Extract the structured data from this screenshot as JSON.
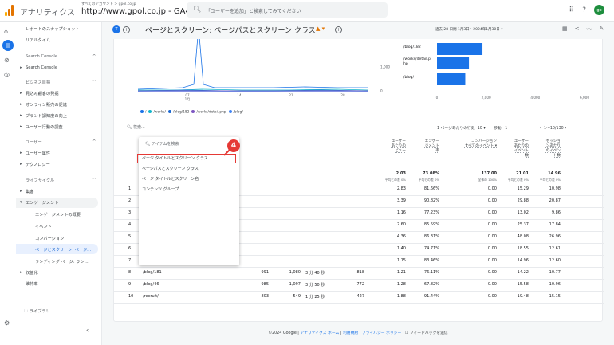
{
  "header": {
    "brand": "アナリティクス",
    "account_breadcrumb": "すべてのアカウント > gpol.co.jp",
    "property": "http://www.gpol.co.jp - GA4",
    "search_placeholder": "「ユーザーを追加」と検索してみてください",
    "avatar_initials": "gp"
  },
  "sidebar": {
    "items": [
      {
        "label": "レポートのスナップショット"
      },
      {
        "label": "リアルタイム"
      },
      {
        "label": "Search Console"
      },
      {
        "label": "Search Console"
      },
      {
        "label": "ビジネス目標"
      },
      {
        "label": "見込み顧客の発掘"
      },
      {
        "label": "オンライン販売の促進"
      },
      {
        "label": "ブランド認知度の向上"
      },
      {
        "label": "ユーザー行動の調査"
      },
      {
        "label": "ユーザー"
      },
      {
        "label": "ユーザー属性"
      },
      {
        "label": "テクノロジー"
      },
      {
        "label": "ライフサイクル"
      },
      {
        "label": "集客"
      },
      {
        "label": "エンゲージメント"
      },
      {
        "label": "エンゲージメントの概要"
      },
      {
        "label": "イベント"
      },
      {
        "label": "コンバージョン"
      },
      {
        "label": "ページとスクリーン: ページ..."
      },
      {
        "label": "ランディング ページ: ラン..."
      },
      {
        "label": "収益化"
      },
      {
        "label": "維持率"
      }
    ],
    "library": "ライブラリ"
  },
  "report": {
    "badge": "T",
    "title": "ページとスクリーン: ページパスとスクリーン クラス",
    "date_range": "過去 28 日間  1月3日～2024年1月30日",
    "warn_icon": "warning-icon"
  },
  "chart_data": {
    "type": "bar",
    "categories": [
      "/blog/182",
      "/works/detail.php",
      "/blog/"
    ],
    "xlim": [
      0,
      6000
    ],
    "x_ticks": [
      "0",
      "2,000",
      "4,000",
      "6,000"
    ],
    "values": [
      1850,
      1300,
      1150
    ],
    "line_chart": {
      "x_ticks": [
        "07\n1月",
        "14",
        "21",
        "28"
      ],
      "y_ticks": [
        "1,000",
        "0"
      ],
      "legend": [
        "/",
        "/works/",
        "/blog/182",
        "/works/detail.php",
        "/blog/"
      ],
      "legend_colors": [
        "#1a73e8",
        "#12b5cb",
        "#1967d2",
        "#7e57c2",
        "#4285f4"
      ]
    },
    "bar_labels": [
      "/blog/182",
      "/works/detail.p\nhp",
      "/blog/"
    ]
  },
  "toolbar": {
    "search_label": "検索...",
    "rows_per_page_label": "1 ページあたりの行数",
    "rows_per_page": "10",
    "goto_label": "移動",
    "goto_value": "1",
    "pager": "1～10/130"
  },
  "columns": [
    {
      "label": "ユーザー\nあたりの\nビュー"
    },
    {
      "label": "エンゲー\nジメント\n率"
    },
    {
      "label": "コンバージョン\nすべてのイベント ▾"
    },
    {
      "label": "ユーザー\nあたりの\nイベント\n数"
    },
    {
      "label": "セッショ\nンあたり\nのイベン\nト数"
    }
  ],
  "totals": [
    {
      "value": "2.03",
      "sub": "平均との差 0%"
    },
    {
      "value": "73.08%",
      "sub": "平均との差 0%"
    },
    {
      "value": "137.00",
      "sub": "全体の 100%"
    },
    {
      "value": "21.01",
      "sub": "平均との差 0%"
    },
    {
      "value": "14.96",
      "sub": "平均との差 0%"
    }
  ],
  "rows": [
    {
      "n": "1",
      "path": "",
      "views": "",
      "users": "",
      "time": "",
      "events": "",
      "vpu": "2.83",
      "er": "81.66%",
      "conv": "0.00",
      "epu": "15.29",
      "eps": "10.98"
    },
    {
      "n": "2",
      "path": "",
      "views": "",
      "users": "",
      "time": "",
      "events": "",
      "vpu": "3.39",
      "er": "90.82%",
      "conv": "0.00",
      "epu": "29.88",
      "eps": "20.87"
    },
    {
      "n": "3",
      "path": "",
      "views": "",
      "users": "",
      "time": "",
      "events": "",
      "vpu": "1.16",
      "er": "77.23%",
      "conv": "0.00",
      "epu": "13.02",
      "eps": "9.86"
    },
    {
      "n": "4",
      "path": "",
      "views": "",
      "users": "",
      "time": "",
      "events": "",
      "vpu": "2.60",
      "er": "85.59%",
      "conv": "0.00",
      "epu": "25.37",
      "eps": "17.84"
    },
    {
      "n": "5",
      "path": "",
      "views": "",
      "users": "",
      "time": "",
      "events": "",
      "vpu": "4.36",
      "er": "86.31%",
      "conv": "0.00",
      "epu": "48.08",
      "eps": "26.96"
    },
    {
      "n": "6",
      "path": "",
      "views": "",
      "users": "",
      "time": "",
      "events": "",
      "vpu": "1.40",
      "er": "74.71%",
      "conv": "0.00",
      "epu": "18.55",
      "eps": "12.61"
    },
    {
      "n": "7",
      "path": "",
      "views": "",
      "users": "",
      "time": "",
      "events": "",
      "vpu": "1.15",
      "er": "83.46%",
      "conv": "0.00",
      "epu": "14.96",
      "eps": "12.60"
    },
    {
      "n": "8",
      "path": "/blog/181",
      "views": "991",
      "users": "1,080",
      "time": "3 分 40 秒",
      "events": "818",
      "vpu": "1.21",
      "er": "76.11%",
      "conv": "0.00",
      "epu": "14.22",
      "eps": "10.77"
    },
    {
      "n": "9",
      "path": "/blog/46",
      "views": "985",
      "users": "1,097",
      "time": "3 分 50 秒",
      "events": "772",
      "vpu": "1.28",
      "er": "67.82%",
      "conv": "0.00",
      "epu": "15.58",
      "eps": "10.96"
    },
    {
      "n": "10",
      "path": "/recruit/",
      "views": "803",
      "users": "549",
      "time": "1 分 25 秒",
      "events": "427",
      "vpu": "1.88",
      "er": "91.44%",
      "conv": "0.00",
      "epu": "19.48",
      "eps": "15.15"
    }
  ],
  "dropdown": {
    "search_placeholder": "アイテムを検索",
    "items": [
      {
        "label": "ページ タイトルとスクリーン クラス"
      },
      {
        "label": "ページパスとスクリーン クラス"
      },
      {
        "label": "ページ タイトルとスクリーン名"
      },
      {
        "label": "コンテンツ グループ"
      }
    ]
  },
  "callout": "4",
  "footer": {
    "copyright": "©2024 Google |",
    "home": "アナリティクス ホーム",
    "sep1": "|",
    "terms": "利用規約",
    "sep2": "|",
    "privacy": "プライバシー ポリシー",
    "sep3": "|",
    "feedback": "フィードバックを送信"
  }
}
